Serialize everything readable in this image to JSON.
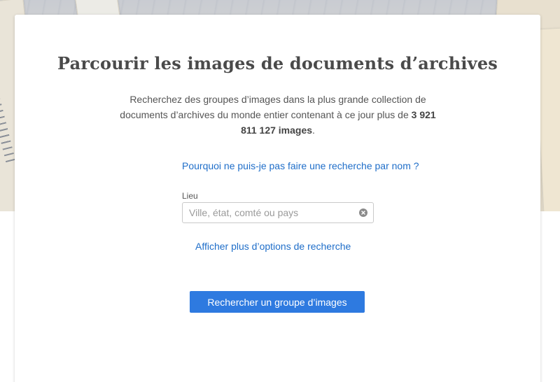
{
  "page": {
    "title": "Parcourir les images de documents d’archives"
  },
  "intro": {
    "text_before": "Recherchez des groupes d’images dans la plus grande collection de documents d’archives du monde entier contenant à ce jour plus de ",
    "image_count": "3 921 811 127 images",
    "text_after": "."
  },
  "links": {
    "why_no_name_search": "Pourquoi ne puis-je pas faire une recherche par nom ?",
    "more_options": "Afficher plus d’options de recherche"
  },
  "location_field": {
    "label": "Lieu",
    "placeholder": "Ville, état, comté ou pays",
    "value": ""
  },
  "search_button": {
    "label": "Rechercher un groupe d’images"
  },
  "colors": {
    "link": "#1f6ec9",
    "button": "#2e7ae0",
    "title": "#4a4a4a"
  },
  "icons": {
    "clear": "clear-circle-x-icon"
  }
}
